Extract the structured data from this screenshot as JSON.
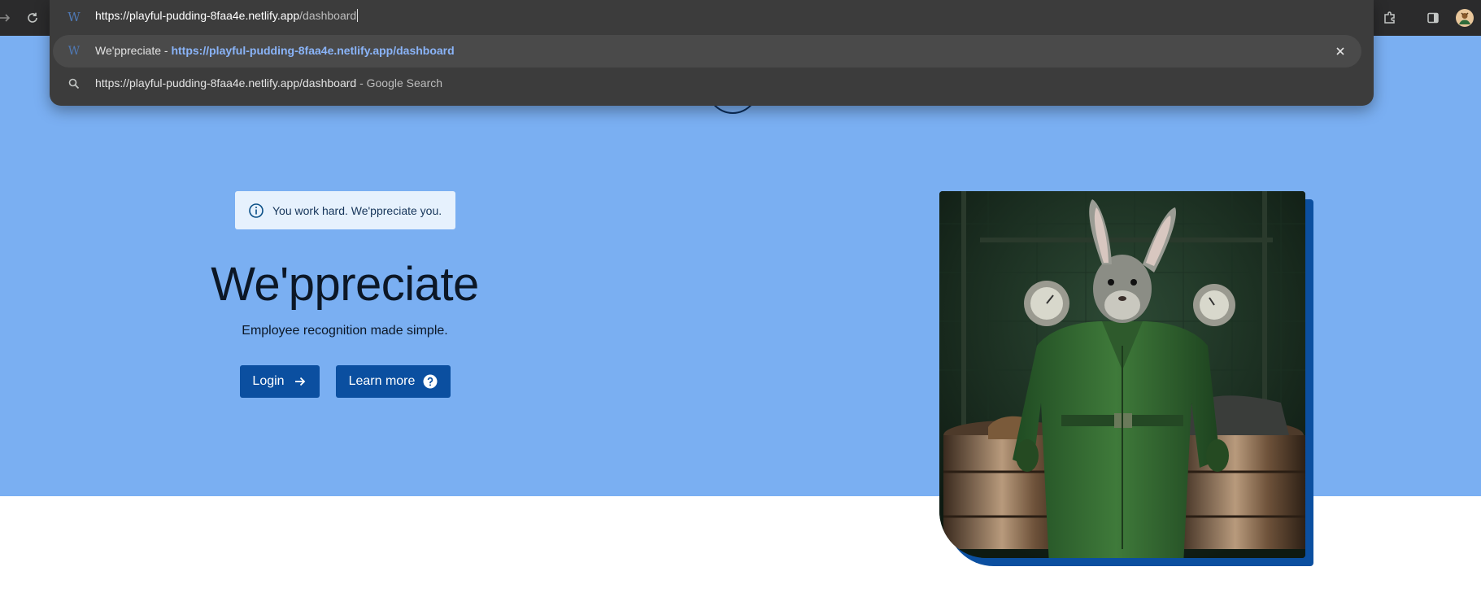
{
  "browser": {
    "omnibox": {
      "favicon": "weppreciate-favicon",
      "url_host": "https://playful-pudding-8faa4e.netlify.app",
      "url_path": "/dashboard",
      "suggestions": [
        {
          "icon": "weppreciate-favicon",
          "title": "We'ppreciate",
          "separator": " - ",
          "url": "https://playful-pudding-8faa4e.netlify.app/dashboard",
          "close_icon": "close-icon"
        },
        {
          "icon": "search-icon",
          "query": "https://playful-pudding-8faa4e.netlify.app/dashboard",
          "suffix": " - Google Search"
        }
      ]
    },
    "toolbar_icons": [
      "forward-icon",
      "reload-icon",
      "extensions-icon",
      "side-panel-icon",
      "profile-avatar"
    ]
  },
  "page": {
    "notice": {
      "icon": "info-icon",
      "text": "You work hard. We'ppreciate you."
    },
    "title": "We'ppreciate",
    "subtitle": "Employee recognition made simple.",
    "buttons": [
      {
        "label": "Login",
        "icon": "arrow-right-icon"
      },
      {
        "label": "Learn more",
        "icon": "help-circle-icon"
      }
    ],
    "hero_image": "rabbit-in-green-coveralls-illustration"
  },
  "colors": {
    "hero_background": "#7aaff2",
    "button_primary": "#0b4fa0",
    "notice_background": "#e6f1fd",
    "toolbar": "#2b2b2c",
    "omnibox": "#3c3c3c",
    "link_blue": "#8ab4f8"
  }
}
